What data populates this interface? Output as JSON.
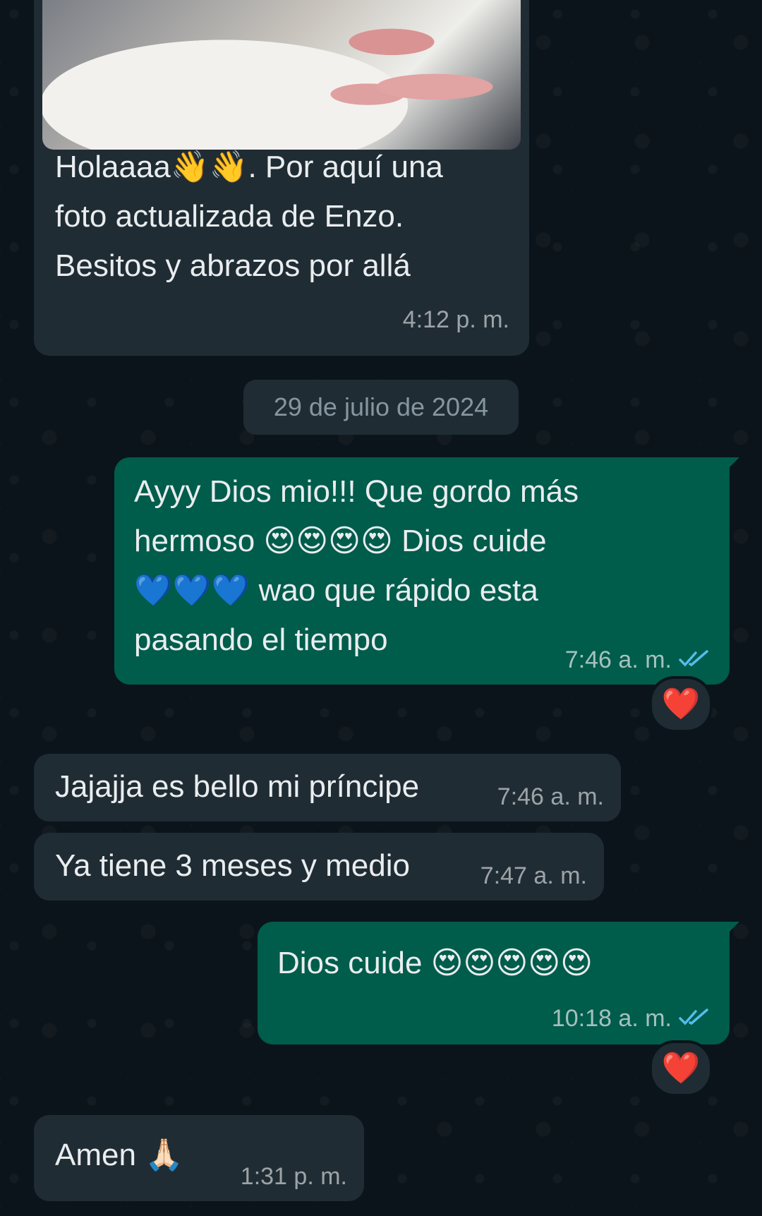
{
  "date_divider": "29 de julio de 2024",
  "messages": [
    {
      "text": "Holaaaa👋👋. Por aquí una\nfoto actualizada de Enzo.\nBesitos y abrazos por allá",
      "time": "4:12 p. m."
    },
    {
      "text": "Ayyy Dios mio!!! Que gordo más\nhermoso 😍😍😍😍 Dios cuide\n💙💙💙 wao que rápido esta\npasando el tiempo",
      "time": "7:46 a. m.",
      "reaction": "❤️"
    },
    {
      "text": "Jajajja es bello mi príncipe",
      "time": "7:46 a. m."
    },
    {
      "text": "Ya tiene 3 meses y medio",
      "time": "7:47 a. m."
    },
    {
      "text": "Dios cuide 😍😍😍😍😍",
      "time": "10:18 a. m.",
      "reaction": "❤️"
    },
    {
      "text": "Amen 🙏🏻",
      "time": "1:31 p. m."
    }
  ],
  "colors": {
    "background": "#0b141a",
    "incoming_bubble": "#202c33",
    "outgoing_bubble": "#005c4b",
    "read_ticks": "#53bdeb"
  },
  "icons": {
    "read_receipt": "double-check-icon",
    "photo": "baby-photo-image"
  }
}
